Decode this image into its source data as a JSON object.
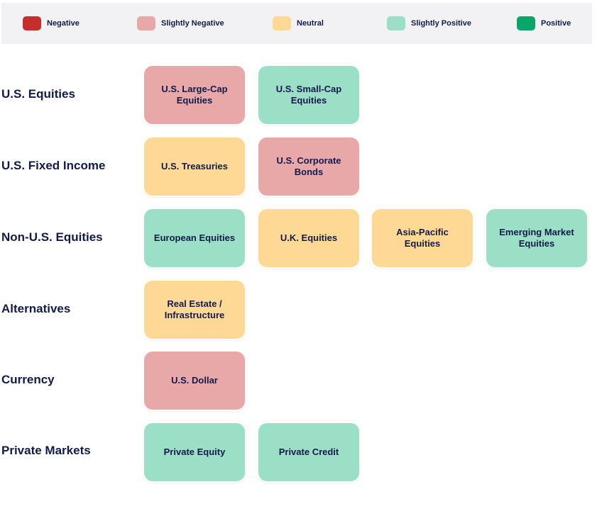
{
  "legend": {
    "items": [
      {
        "label": "Negative",
        "color": "#c62d2d"
      },
      {
        "label": "Slightly Negative",
        "color": "#e8a8a8"
      },
      {
        "label": "Neutral",
        "color": "#fdd995"
      },
      {
        "label": "Slightly Positive",
        "color": "#9adfc6"
      },
      {
        "label": "Positive",
        "color": "#0aa56b"
      }
    ]
  },
  "rows": [
    {
      "label": "U.S. Equities",
      "tiles": [
        {
          "label": "U.S. Large-Cap Equities",
          "rating": "Slightly Negative"
        },
        {
          "label": "U.S. Small-Cap Equities",
          "rating": "Slightly Positive"
        }
      ]
    },
    {
      "label": "U.S. Fixed Income",
      "tiles": [
        {
          "label": "U.S. Treasuries",
          "rating": "Neutral"
        },
        {
          "label": "U.S. Corporate Bonds",
          "rating": "Slightly Negative"
        }
      ]
    },
    {
      "label": "Non-U.S. Equities",
      "tiles": [
        {
          "label": "European Equities",
          "rating": "Slightly Positive"
        },
        {
          "label": "U.K. Equities",
          "rating": "Neutral"
        },
        {
          "label": "Asia-Pacific Equities",
          "rating": "Neutral"
        },
        {
          "label": "Emerging Market Equities",
          "rating": "Slightly Positive"
        }
      ]
    },
    {
      "label": "Alternatives",
      "tiles": [
        {
          "label": "Real Estate / Infrastructure",
          "rating": "Neutral"
        }
      ]
    },
    {
      "label": "Currency",
      "tiles": [
        {
          "label": "U.S. Dollar",
          "rating": "Slightly Negative"
        }
      ]
    },
    {
      "label": "Private Markets",
      "tiles": [
        {
          "label": "Private Equity",
          "rating": "Slightly Positive"
        },
        {
          "label": "Private Credit",
          "rating": "Slightly Positive"
        }
      ]
    }
  ]
}
